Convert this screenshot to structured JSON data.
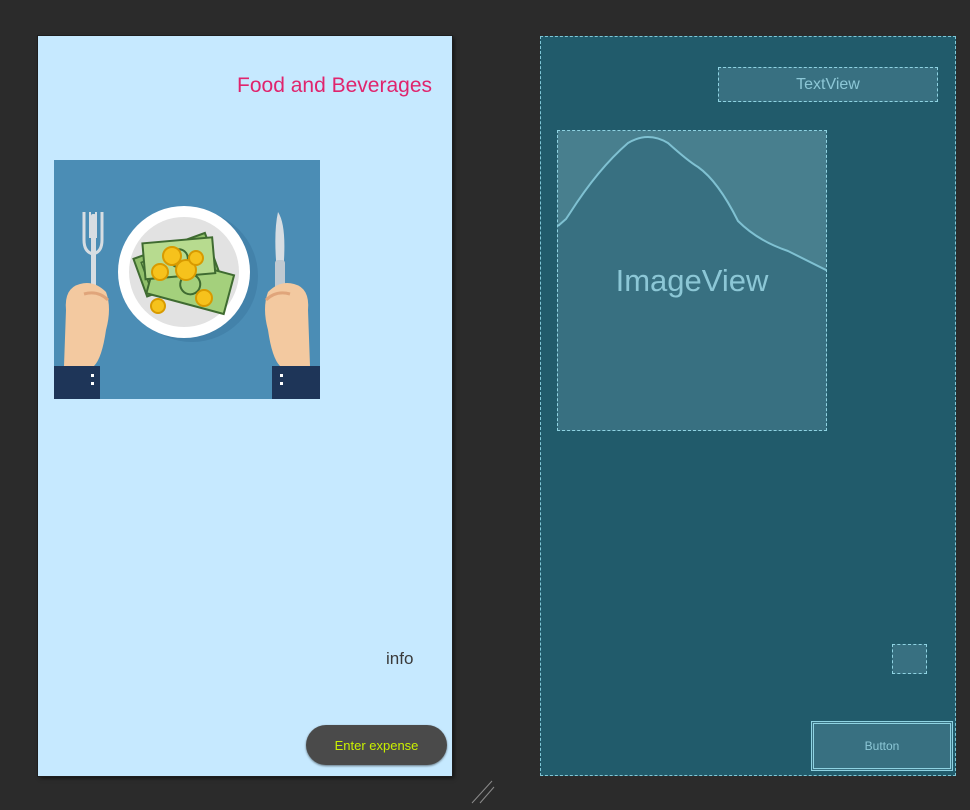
{
  "design": {
    "title": "Food and Beverages",
    "info_label": "info",
    "button_label": "Enter expense"
  },
  "blueprint": {
    "textview_label": "TextView",
    "imageview_label": "ImageView",
    "button_label": "Button"
  },
  "colors": {
    "canvas_background": "#2b2b2b",
    "design_background": "#c6e9ff",
    "title_color": "#e0246d",
    "button_background": "#4a4a4a",
    "button_text": "#c9f000",
    "blueprint_background": "#215b6b",
    "blueprint_outline": "#8fd3e2"
  },
  "icons": {
    "image_content": "food-money-plate-illustration",
    "imageview_placeholder": "mountain-placeholder-icon",
    "resize": "resize-handle-icon"
  }
}
